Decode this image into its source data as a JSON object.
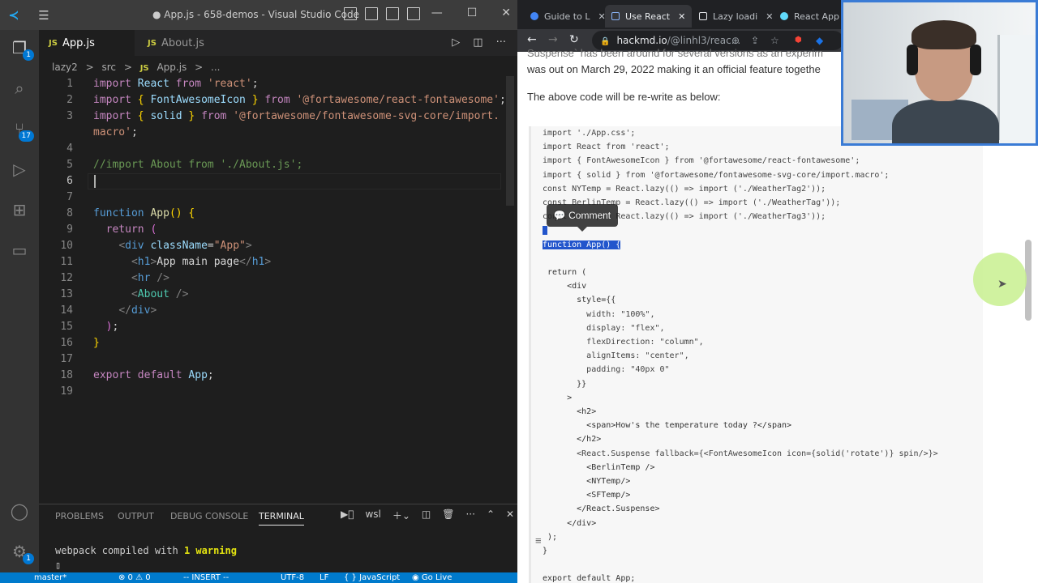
{
  "vscode": {
    "title": "● App.js - 658-demos - Visual Studio Code",
    "tabs": [
      {
        "lang": "JS",
        "label": "App.js"
      },
      {
        "lang": "JS",
        "label": "About.js"
      }
    ],
    "breadcrumb": [
      "lazy2",
      ">",
      "src",
      ">",
      "JS",
      "App.js",
      ">",
      "..."
    ],
    "badges": {
      "explorer": "1",
      "scm": "17",
      "settings": "1"
    },
    "code": [
      {
        "n": "1",
        "parts": [
          [
            "kw",
            "import"
          ],
          [
            "",
            " "
          ],
          [
            "var",
            "React"
          ],
          [
            "",
            " "
          ],
          [
            "kw",
            "from"
          ],
          [
            "",
            " "
          ],
          [
            "str",
            "'react'"
          ],
          [
            "",
            ";"
          ]
        ]
      },
      {
        "n": "2",
        "parts": [
          [
            "kw",
            "import"
          ],
          [
            "",
            " "
          ],
          [
            "gold",
            "{"
          ],
          [
            "",
            " "
          ],
          [
            "var",
            "FontAwesomeIcon"
          ],
          [
            "",
            " "
          ],
          [
            "gold",
            "}"
          ],
          [
            "",
            " "
          ],
          [
            "kw",
            "from"
          ],
          [
            "",
            " "
          ],
          [
            "str",
            "'@fortawesome/react-fontawesome'"
          ],
          [
            "",
            ";"
          ]
        ]
      },
      {
        "n": "3",
        "parts": [
          [
            "kw",
            "import"
          ],
          [
            "",
            " "
          ],
          [
            "gold",
            "{"
          ],
          [
            "",
            " "
          ],
          [
            "var",
            "solid"
          ],
          [
            "",
            " "
          ],
          [
            "gold",
            "}"
          ],
          [
            "",
            " "
          ],
          [
            "kw",
            "from"
          ],
          [
            "",
            " "
          ],
          [
            "str",
            "'@fortawesome/fontawesome-svg-core/import."
          ]
        ]
      },
      {
        "n": "",
        "parts": [
          [
            "str",
            "macro'"
          ],
          [
            "",
            ";"
          ]
        ]
      },
      {
        "n": "4",
        "parts": []
      },
      {
        "n": "5",
        "parts": [
          [
            "com",
            "//import About from './About.js';"
          ]
        ]
      },
      {
        "n": "6",
        "parts": []
      },
      {
        "n": "7",
        "parts": []
      },
      {
        "n": "8",
        "parts": [
          [
            "kw2",
            "function"
          ],
          [
            "",
            " "
          ],
          [
            "fn",
            "App"
          ],
          [
            "gold",
            "()"
          ],
          [
            "",
            " "
          ],
          [
            "gold",
            "{"
          ]
        ]
      },
      {
        "n": "9",
        "parts": [
          [
            "",
            "  "
          ],
          [
            "kw",
            "return"
          ],
          [
            "",
            " "
          ],
          [
            "pur",
            "("
          ]
        ]
      },
      {
        "n": "10",
        "parts": [
          [
            "",
            "    "
          ],
          [
            "brk",
            "<"
          ],
          [
            "tag",
            "div"
          ],
          [
            "",
            " "
          ],
          [
            "var",
            "className"
          ],
          [
            "",
            "="
          ],
          [
            "str",
            "\"App\""
          ],
          [
            "brk",
            ">"
          ]
        ]
      },
      {
        "n": "11",
        "parts": [
          [
            "",
            "      "
          ],
          [
            "brk",
            "<"
          ],
          [
            "tag",
            "h1"
          ],
          [
            "brk",
            ">"
          ],
          [
            "",
            "App main page"
          ],
          [
            "brk",
            "</"
          ],
          [
            "tag",
            "h1"
          ],
          [
            "brk",
            ">"
          ]
        ]
      },
      {
        "n": "12",
        "parts": [
          [
            "",
            "      "
          ],
          [
            "brk",
            "<"
          ],
          [
            "tag",
            "hr"
          ],
          [
            "",
            " "
          ],
          [
            "brk",
            "/>"
          ]
        ]
      },
      {
        "n": "13",
        "parts": [
          [
            "",
            "      "
          ],
          [
            "brk",
            "<"
          ],
          [
            "cls",
            "About"
          ],
          [
            "",
            " "
          ],
          [
            "brk",
            "/>"
          ]
        ]
      },
      {
        "n": "14",
        "parts": [
          [
            "",
            "    "
          ],
          [
            "brk",
            "</"
          ],
          [
            "tag",
            "div"
          ],
          [
            "brk",
            ">"
          ]
        ]
      },
      {
        "n": "15",
        "parts": [
          [
            "",
            "  "
          ],
          [
            "pur",
            ")"
          ],
          [
            "",
            ";"
          ]
        ]
      },
      {
        "n": "16",
        "parts": [
          [
            "gold",
            "}"
          ]
        ]
      },
      {
        "n": "17",
        "parts": []
      },
      {
        "n": "18",
        "parts": [
          [
            "kw",
            "export"
          ],
          [
            "",
            " "
          ],
          [
            "kw",
            "default"
          ],
          [
            "",
            " "
          ],
          [
            "var",
            "App"
          ],
          [
            "",
            ";"
          ]
        ]
      },
      {
        "n": "19",
        "parts": []
      }
    ],
    "panel": {
      "tabs": [
        "PROBLEMS",
        "OUTPUT",
        "DEBUG CONSOLE",
        "TERMINAL"
      ],
      "shell": "wsl",
      "output_prefix": "webpack compiled with ",
      "output_warn": "1 warning",
      "prompt": "▯"
    },
    "status": {
      "branch": "master*",
      "errors": "⊗ 0 ⚠ 0",
      "mode": "-- INSERT --",
      "encoding": "UTF-8",
      "eol": "LF",
      "language": "{ } JavaScript",
      "golive": "◉ Go Live"
    }
  },
  "browser": {
    "tabs": [
      {
        "label": "Guide to L",
        "fav": "#4285f4"
      },
      {
        "label": "Use React",
        "fav": "#1a73e8"
      },
      {
        "label": "Lazy loadi",
        "fav": "#e8eaed"
      },
      {
        "label": "React App",
        "fav": "#61dafb"
      }
    ],
    "url_host": "hackmd.io",
    "url_path": "/@linhl3/reac...",
    "para1": "Suspense` has been around for several versions as an experim",
    "para2": "was out on March 29, 2022 making it an official feature togethe",
    "para3": "The above code will be re-write as below:",
    "comment_label": "💬 Comment",
    "code": [
      "import './App.css';",
      "import React from 'react';",
      "import { FontAwesomeIcon } from '@fortawesome/react-fontawesome';",
      "import { solid } from '@fortawesome/fontawesome-svg-core/import.macro';",
      "const NYTemp = React.lazy(() => import ('./WeatherTag2'));",
      "const BerlinTemp = React.lazy(() => import ('./WeatherTag'));",
      "const SFTemp = React.lazy(() => import ('./WeatherTag3'));",
      "",
      "function App() {",
      "",
      " return (",
      "     <div",
      "       style={{",
      "         width: \"100%\",",
      "         display: \"flex\",",
      "         flexDirection: \"column\",",
      "         alignItems: \"center\",",
      "         padding: \"40px 0\"",
      "       }}",
      "     >",
      "       <h2>",
      "         <span>How's the temperature today ?</span>",
      "       </h2>",
      "       <React.Suspense fallback={<FontAwesomeIcon icon={solid('rotate')} spin/>}>",
      "         <BerlinTemp />",
      "         <NYTemp/>",
      "         <SFTemp/>",
      "       </React.Suspense>",
      "     </div>",
      " );",
      "}",
      "",
      "export default App;"
    ]
  }
}
